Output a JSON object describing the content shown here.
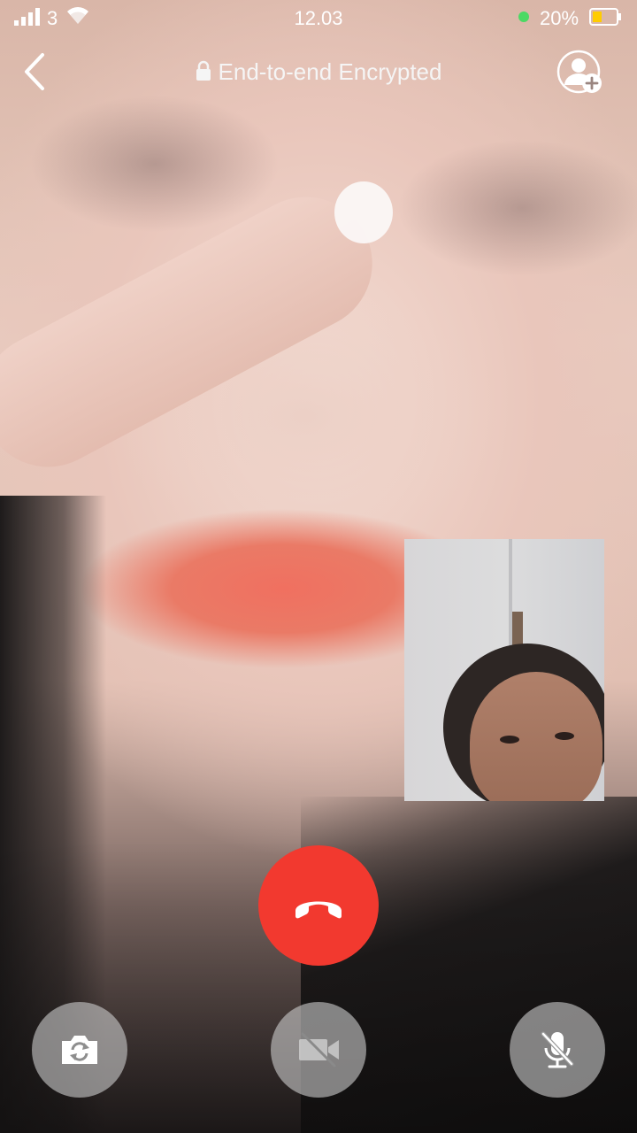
{
  "status_bar": {
    "carrier_label": "3",
    "time": "12.03",
    "battery_percent": "20%",
    "battery_level": 0.2,
    "colors": {
      "battery_dot": "#4cd964",
      "battery_fill": "#ffcc00"
    }
  },
  "header": {
    "encryption_label": "End-to-end Encrypted",
    "back_icon": "chevron-left-icon",
    "add_user_icon": "add-user-icon",
    "lock_icon": "lock-icon"
  },
  "controls": {
    "end_call_icon": "phone-hangup-icon",
    "flip_camera_icon": "camera-switch-icon",
    "video_icon": "video-off-icon",
    "mute_icon": "mic-off-icon",
    "colors": {
      "end_call": "#f2392f"
    }
  }
}
